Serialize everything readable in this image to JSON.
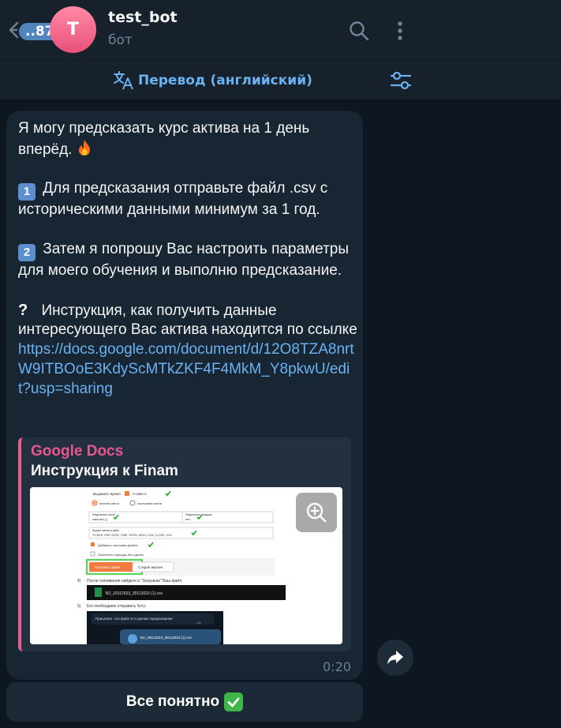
{
  "header": {
    "unread_count": "..87",
    "avatar_letter": "T",
    "chat_title": "test_bot",
    "chat_subtitle": "бот"
  },
  "translate_bar": {
    "label": "Перевод (английский)"
  },
  "message": {
    "intro_line1": "Я могу предсказать курс актива на 1 день",
    "intro_line2": "вперёд.",
    "step1_badge": "1",
    "step1_text": "Для предсказания отправьте файл .csv с историческими данными минимум за 1 год.",
    "step2_badge": "2",
    "step2_text": "Затем я попрошу Вас настроить параметры для моего обучения и выполню предсказание.",
    "question_mark": "?",
    "instruction_text": "Инструкция, как получить данные интересующего Вас актива находится по ссылке",
    "link_url": "https://docs.google.com/document/d/12O8TZA8nrtW9ITBOoE3KdyScMTkZKF4F4MkM_Y8pkwU/edit?usp=sharing",
    "time": "0:20"
  },
  "link_preview": {
    "site_name": "Google Docs",
    "title": "Инструкция к Finam",
    "doc": {
      "row1": "Выдавать время",
      "row1b": "чч:мм:сс",
      "radio1": "начала свечи",
      "radio2": "окончания свечи",
      "field1_label": "Разделитель полей",
      "field1_value": "запятая (,)",
      "field2_label": "Разделитель разрядов",
      "field2_value": "нет",
      "format_label": "Формат записи в файл",
      "format_value": "TICKER, PER, DATE, TIME, OPEN, HIGH, LOW, CLOSE, VOL",
      "checkbox1": "Добавить заголовок файла",
      "checkbox2": "Заполнять периоды без сделок",
      "btn_get_file": "Получить файл",
      "btn_old": "Старая версия",
      "step4_num": "4)",
      "step4_text": "После скачивания найдите в \"Загрузках\" Ваш файл:",
      "file_name": "BZ_29112023_30112023 (1).csv",
      "step5_num": "5)",
      "step5_text": "Его необходимо отправить боту:",
      "chat_prompt": "Пришлите .csv файл и я сделаю предсказание",
      "chat_edit": "edit",
      "chat_file": "BZ_29112023_30112023 (1).csv"
    }
  },
  "keyboard": {
    "button_label": "Все понятно"
  },
  "colors": {
    "background": "#0e1621",
    "header": "#17212b",
    "bubble": "#182533",
    "link": "#6ab2f2",
    "preview_accent": "#e85d8e",
    "avatar": "#ff7a9a"
  },
  "icons": [
    "back-arrow-icon",
    "search-icon",
    "more-vertical-icon",
    "translate-icon",
    "settings-sliders-icon",
    "fire-emoji-icon",
    "keycap-1-icon",
    "keycap-2-icon",
    "question-mark-icon",
    "zoom-in-icon",
    "forward-arrow-icon",
    "check-mark-emoji-icon"
  ]
}
